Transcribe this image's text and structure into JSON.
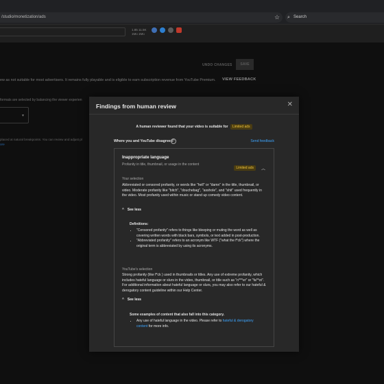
{
  "browser": {
    "url": "/studio/monetization/ads",
    "search_label": "Search"
  },
  "studio": {
    "stats_line1": "1.85",
    "stats_line2": "1Mo",
    "stats_line3": "11.5K",
    "stats_line4": "1Mo",
    "undo_label": "UNDO CHANGES",
    "save_label": "SAVE",
    "status_text": "ew as not suitable for most advertisers. It remains fully playable and is eligible to earn subscription revenue from YouTube Premium.",
    "view_feedback_label": "VIEW FEEDBACK",
    "formats_text": "formats are selected by balancing the viewer experien",
    "breaks_text": "placed at natural breakpoints. You can review and adjust pl",
    "link_text": "ore"
  },
  "modal": {
    "title": "Findings from human review",
    "summary_text": "A human reviewer found that your video is suitable for",
    "summary_badge": "Limited ads",
    "disagree_label": "Where you and YouTube disagreed",
    "send_feedback_label": "Send feedback",
    "card": {
      "title": "Inappropriate language",
      "subtitle": "Profanity in title, thumbnail, or usage in the content",
      "badge": "Limited ads",
      "your_heading": "Your selection",
      "your_body": "Abbreviated or censored profanity, or words like \"hell\" or \"damn\" in the title, thumbnail, or video. Moderate profanity like \"bitch\", \"douchebag\", \"asshole\", and \"shit\" used frequently in the video. Most profanity used within music or stand up comedy video content.",
      "see_less_1": "See less",
      "definitions_heading": "Definitions:",
      "definitions": [
        "\"Censored profanity\" refers to things like bleeping or muting the word as well as covering written words with black bars, symbols, or text added in post-production.",
        "\"Abbreviated profanity\" refers to an acronym like WTF (\"what the f*ck\") where the original term is abbreviated by using its acronyms."
      ],
      "youtube_heading": "YouTube's selection",
      "youtube_body": "Strong profanity (like f*ck ) used in thumbnails or titles. Any use of extreme profanity, which includes hateful language or slurs in the video, thumbnail, or title such as \"n***er\" or \"fa**ot\". For additional information about hateful language or slurs, you may also refer to our hateful & derogatory content guideline within our Help Center.",
      "see_less_2": "See less",
      "examples_heading": "Some examples of content that also fall into this category.",
      "example_prefix": "Any use of hateful language in the video. Please refer to",
      "example_link": "hateful & derogatory content",
      "example_suffix": "for more info."
    }
  }
}
